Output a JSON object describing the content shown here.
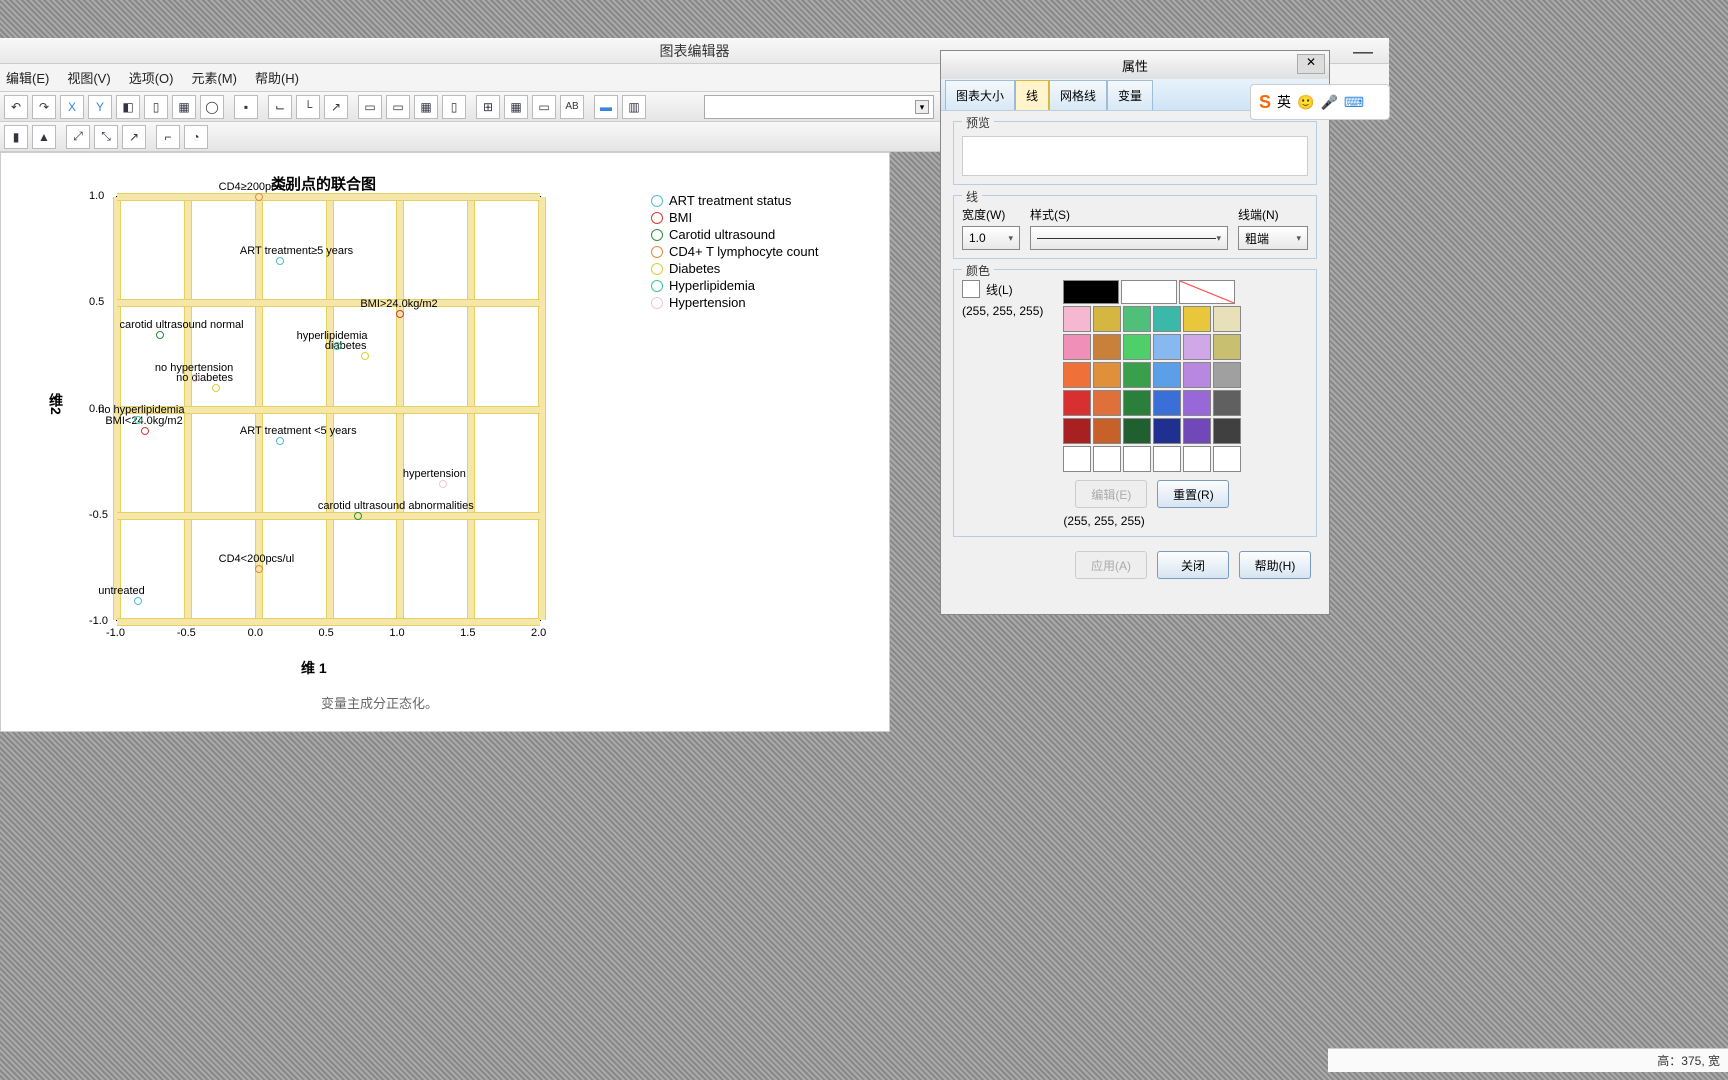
{
  "app": {
    "title": "图表编辑器",
    "minimize": "—"
  },
  "menus": {
    "edit": "编辑(E)",
    "view": "视图(V)",
    "options": "选项(O)",
    "elements": "元素(M)",
    "help": "帮助(H)"
  },
  "dialog": {
    "title": "属性",
    "close": "✕",
    "tabs": {
      "size": "图表大小",
      "line": "线",
      "grid": "网格线",
      "var": "变量"
    },
    "preview_label": "预览",
    "line_group_label": "线",
    "width_label": "宽度(W)",
    "width_value": "1.0",
    "style_label": "样式(S)",
    "cap_label": "线端(N)",
    "cap_value": "粗端",
    "color_group_label": "颜色",
    "line_color_label": "线(L)",
    "rgb1": "(255, 255, 255)",
    "rgb2": "(255, 255, 255)",
    "edit_btn": "编辑(E)",
    "reset_btn": "重置(R)",
    "apply_btn": "应用(A)",
    "close_btn": "关闭",
    "help_btn": "帮助(H)"
  },
  "status": "高：375,  宽",
  "ime": {
    "logo": "S",
    "lang": "英"
  },
  "chart_data": {
    "type": "scatter",
    "title": "类别点的联合图",
    "xlabel": "维 1",
    "ylabel": "维2",
    "caption": "变量主成分正态化。",
    "xlim": [
      -1.0,
      2.0
    ],
    "ylim": [
      -1.0,
      1.0
    ],
    "xticks": [
      -1.0,
      -0.5,
      0.0,
      0.5,
      1.0,
      1.5,
      2.0
    ],
    "yticks": [
      -1.0,
      -0.5,
      0.0,
      0.5,
      1.0
    ],
    "series": [
      {
        "name": "ART treatment status",
        "color": "#4fbed6",
        "points": [
          {
            "x": 0.15,
            "y": 0.7,
            "label": "ART treatment≥5 years"
          },
          {
            "x": 0.15,
            "y": -0.15,
            "label": "ART treatment <5 years"
          },
          {
            "x": -0.85,
            "y": -0.9,
            "label": "untreated"
          }
        ]
      },
      {
        "name": "BMI",
        "color": "#d63838",
        "points": [
          {
            "x": 1.0,
            "y": 0.45,
            "label": "BMI>24.0kg/m2"
          },
          {
            "x": -0.8,
            "y": -0.1,
            "label": "BMI<24.0kg/m2"
          }
        ]
      },
      {
        "name": "Carotid ultrasound",
        "color": "#2a8f3a",
        "points": [
          {
            "x": -0.7,
            "y": 0.35,
            "label": "carotid ultrasound normal"
          },
          {
            "x": 0.7,
            "y": -0.5,
            "label": "carotid ultrasound abnormalities"
          }
        ]
      },
      {
        "name": "CD4+ T lymphocyte count",
        "color": "#e08a3a",
        "points": [
          {
            "x": 0.0,
            "y": 1.0,
            "label": "CD4≥200pcs/ul"
          },
          {
            "x": 0.0,
            "y": -0.75,
            "label": "CD4<200pcs/ul"
          }
        ]
      },
      {
        "name": "Diabetes",
        "color": "#d8d03a",
        "points": [
          {
            "x": 0.75,
            "y": 0.25,
            "label": "diabetes"
          },
          {
            "x": -0.3,
            "y": 0.1,
            "label": "no diabetes"
          }
        ]
      },
      {
        "name": "Hyperlipidemia",
        "color": "#3ac69e",
        "points": [
          {
            "x": 0.55,
            "y": 0.3,
            "label": "hyperlipidemia"
          },
          {
            "x": -0.85,
            "y": -0.05,
            "label": "no hyperlipidemia"
          }
        ]
      },
      {
        "name": "Hypertension",
        "color": "#f2c6d6",
        "points": [
          {
            "x": 1.3,
            "y": -0.35,
            "label": "hypertension"
          },
          {
            "x": -0.45,
            "y": 0.15,
            "label": "no hypertension"
          }
        ]
      }
    ]
  },
  "palette_colors": [
    [
      "#000000",
      "#ffffff",
      "#ffffff"
    ],
    [
      "#f5b8d0",
      "#d4b640",
      "#4fbf7a",
      "#3ab8a8",
      "#e8c83a",
      "#e8e0b8"
    ],
    [
      "#f090b8",
      "#c8803a",
      "#4fcf6a",
      "#88b8f0",
      "#d0a8e8",
      "#c8c070"
    ],
    [
      "#f0703a",
      "#e0903a",
      "#3a9f4a",
      "#5a9fe8",
      "#b888e0",
      "#a0a0a0"
    ],
    [
      "#d83030",
      "#e0703a",
      "#2a7f3a",
      "#3a6fd8",
      "#9868d8",
      "#606060"
    ],
    [
      "#a82020",
      "#c8602a",
      "#206030",
      "#203090",
      "#7048b8",
      "#404040"
    ],
    [
      "",
      "",
      "",
      "",
      "",
      ""
    ]
  ]
}
